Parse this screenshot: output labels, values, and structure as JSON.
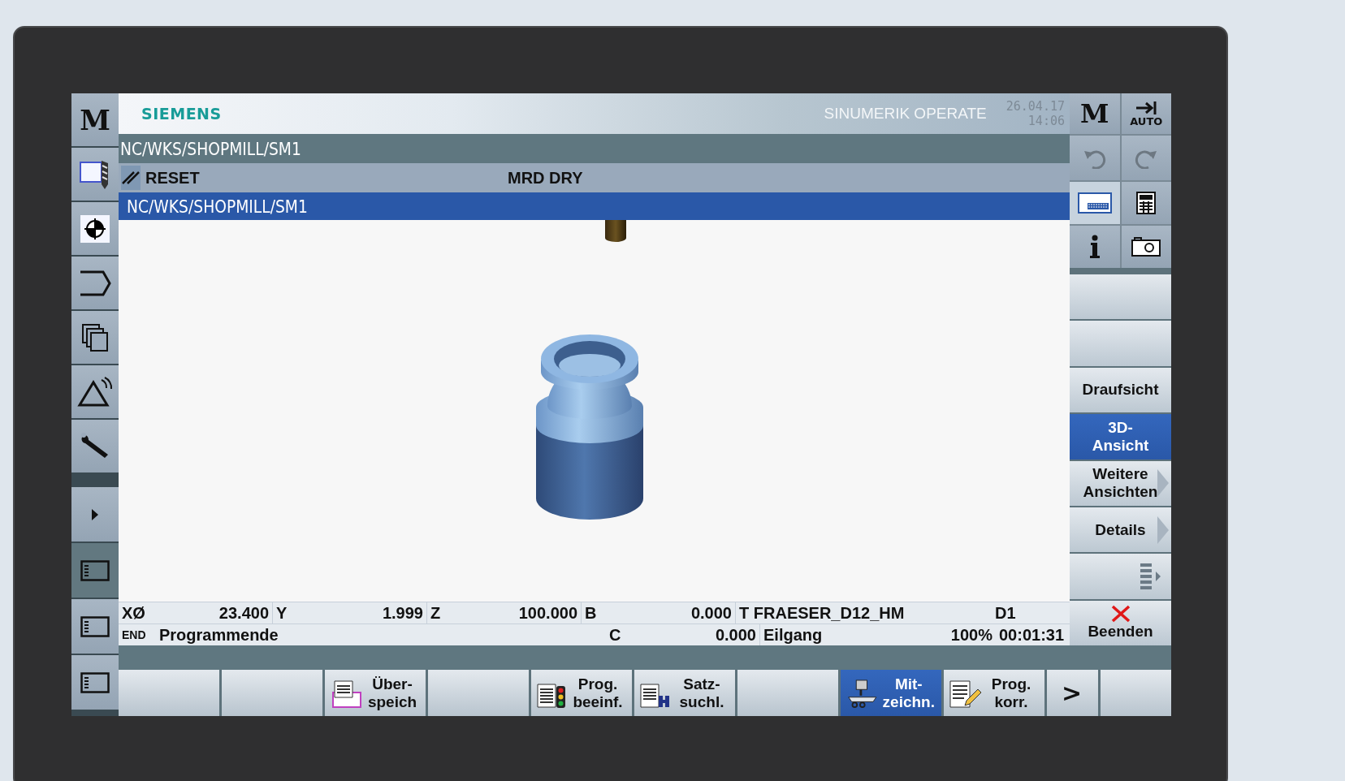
{
  "header": {
    "brand": "SIEMENS",
    "product": "SINUMERIK OPERATE",
    "date": "26.04.17",
    "time": "14:06"
  },
  "program_path": "NC/WKS/SHOPMILL/SM1",
  "status": {
    "reset_label": "RESET",
    "modes": "MRD DRY"
  },
  "selected_program": "NC/WKS/SHOPMILL/SM1",
  "left_sidebar": [
    {
      "kind": "letter",
      "label": "M",
      "selected": false
    },
    {
      "kind": "tool",
      "selected": false
    },
    {
      "kind": "center",
      "selected": false
    },
    {
      "kind": "contour",
      "selected": false
    },
    {
      "kind": "copy",
      "selected": false
    },
    {
      "kind": "alarm",
      "selected": false
    },
    {
      "kind": "wrench",
      "selected": false
    },
    {
      "kind": "arrow",
      "selected": false
    },
    {
      "kind": "window",
      "selected": true
    },
    {
      "kind": "window",
      "selected": false
    },
    {
      "kind": "window",
      "selected": false
    }
  ],
  "top_buttons": [
    {
      "kind": "letter",
      "label": "M",
      "selected": false
    },
    {
      "kind": "auto",
      "label": "AUTO",
      "selected": false
    },
    {
      "kind": "undo",
      "selected": false
    },
    {
      "kind": "redo",
      "selected": false
    },
    {
      "kind": "keyboard",
      "selected": true
    },
    {
      "kind": "calculator",
      "selected": false
    },
    {
      "kind": "info",
      "selected": false
    },
    {
      "kind": "camera",
      "selected": false
    }
  ],
  "vertical_softkeys": [
    {
      "kind": "blank",
      "selected": false
    },
    {
      "kind": "blank",
      "selected": false
    },
    {
      "kind": "text",
      "lines": [
        "Draufsicht"
      ],
      "selected": false
    },
    {
      "kind": "text",
      "lines": [
        "3D-",
        "Ansicht"
      ],
      "selected": true
    },
    {
      "kind": "menu",
      "lines": [
        "Weitere",
        "Ansichten"
      ],
      "selected": false
    },
    {
      "kind": "menu",
      "lines": [
        "Details"
      ],
      "selected": false
    },
    {
      "kind": "more",
      "selected": false
    },
    {
      "kind": "close",
      "lines": [
        "Beenden"
      ],
      "selected": false
    }
  ],
  "readout": {
    "row_1": [
      {
        "kind": "label",
        "text": "XØ"
      },
      {
        "kind": "value",
        "text": "23.400"
      },
      {
        "kind": "label",
        "text": "Y"
      },
      {
        "kind": "value",
        "text": "1.999"
      },
      {
        "kind": "label",
        "text": "Z"
      },
      {
        "kind": "value",
        "text": "100.000"
      },
      {
        "kind": "label",
        "text": "B"
      },
      {
        "kind": "value",
        "text": "0.000"
      },
      {
        "kind": "wide",
        "text": "T FRAESER_D12_HM"
      },
      {
        "kind": "fill",
        "text": "D1"
      }
    ],
    "row_2": [
      {
        "kind": "small",
        "text": "END"
      },
      {
        "kind": "long",
        "text": "Programmende"
      },
      {
        "kind": "label",
        "text": "C"
      },
      {
        "kind": "value",
        "text": "0.000"
      },
      {
        "kind": "mid",
        "text": "Eilgang"
      },
      {
        "kind": "pct",
        "text": "100%"
      },
      {
        "kind": "fill",
        "text": "00:01:31"
      }
    ]
  },
  "horizontal_softkeys": [
    {
      "kind": "blank",
      "selected": false
    },
    {
      "kind": "blank",
      "selected": false
    },
    {
      "kind": "overstore",
      "lines": [
        "Über-",
        "speich"
      ],
      "selected": false
    },
    {
      "kind": "blank",
      "selected": false
    },
    {
      "kind": "control",
      "lines": [
        "Prog.",
        "beeinf."
      ],
      "selected": false
    },
    {
      "kind": "search",
      "lines": [
        "Satz-",
        "suchl."
      ],
      "selected": false
    },
    {
      "kind": "blank",
      "selected": false
    },
    {
      "kind": "simulate",
      "lines": [
        "Mit-",
        "zeichn."
      ],
      "selected": true
    },
    {
      "kind": "edit",
      "lines": [
        "Prog.",
        "korr."
      ],
      "selected": false
    },
    {
      "kind": "next",
      "lines": [
        ">"
      ],
      "selected": false
    },
    {
      "kind": "end",
      "selected": false
    }
  ]
}
